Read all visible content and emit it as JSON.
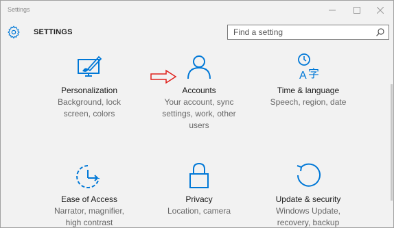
{
  "window": {
    "title": "Settings"
  },
  "header": {
    "app_title": "SETTINGS",
    "search_placeholder": "Find a setting"
  },
  "tiles": [
    {
      "name": "Personalization",
      "desc1": "Background, lock",
      "desc2": "screen, colors",
      "desc3": "",
      "icon": "personalization-icon"
    },
    {
      "name": "Accounts",
      "desc1": "Your account, sync",
      "desc2": "settings, work, other",
      "desc3": "users",
      "icon": "accounts-icon"
    },
    {
      "name": "Time & language",
      "desc1": "Speech, region, date",
      "desc2": "",
      "desc3": "",
      "icon": "time-language-icon"
    },
    {
      "name": "Ease of Access",
      "desc1": "Narrator, magnifier,",
      "desc2": "high contrast",
      "desc3": "",
      "icon": "ease-of-access-icon"
    },
    {
      "name": "Privacy",
      "desc1": "Location, camera",
      "desc2": "",
      "desc3": "",
      "icon": "privacy-lock-icon"
    },
    {
      "name": "Update & security",
      "desc1": "Windows Update,",
      "desc2": "recovery, backup",
      "desc3": "",
      "icon": "update-security-icon"
    }
  ],
  "colors": {
    "accent": "#0078d7",
    "annotation_arrow": "#e0201b",
    "background": "#f2f2f2"
  }
}
